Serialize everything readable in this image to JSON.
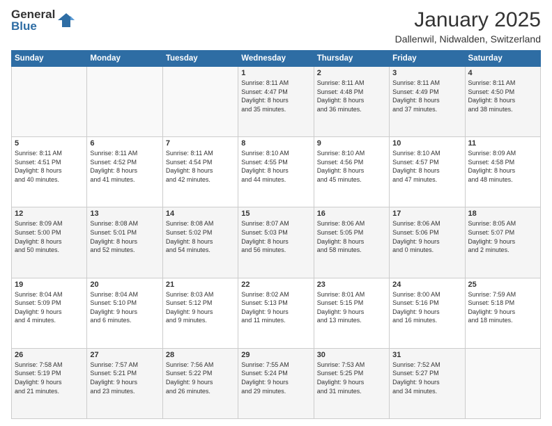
{
  "logo": {
    "general": "General",
    "blue": "Blue"
  },
  "title": "January 2025",
  "location": "Dallenwil, Nidwalden, Switzerland",
  "days_header": [
    "Sunday",
    "Monday",
    "Tuesday",
    "Wednesday",
    "Thursday",
    "Friday",
    "Saturday"
  ],
  "weeks": [
    [
      {
        "day": "",
        "info": ""
      },
      {
        "day": "",
        "info": ""
      },
      {
        "day": "",
        "info": ""
      },
      {
        "day": "1",
        "info": "Sunrise: 8:11 AM\nSunset: 4:47 PM\nDaylight: 8 hours\nand 35 minutes."
      },
      {
        "day": "2",
        "info": "Sunrise: 8:11 AM\nSunset: 4:48 PM\nDaylight: 8 hours\nand 36 minutes."
      },
      {
        "day": "3",
        "info": "Sunrise: 8:11 AM\nSunset: 4:49 PM\nDaylight: 8 hours\nand 37 minutes."
      },
      {
        "day": "4",
        "info": "Sunrise: 8:11 AM\nSunset: 4:50 PM\nDaylight: 8 hours\nand 38 minutes."
      }
    ],
    [
      {
        "day": "5",
        "info": "Sunrise: 8:11 AM\nSunset: 4:51 PM\nDaylight: 8 hours\nand 40 minutes."
      },
      {
        "day": "6",
        "info": "Sunrise: 8:11 AM\nSunset: 4:52 PM\nDaylight: 8 hours\nand 41 minutes."
      },
      {
        "day": "7",
        "info": "Sunrise: 8:11 AM\nSunset: 4:54 PM\nDaylight: 8 hours\nand 42 minutes."
      },
      {
        "day": "8",
        "info": "Sunrise: 8:10 AM\nSunset: 4:55 PM\nDaylight: 8 hours\nand 44 minutes."
      },
      {
        "day": "9",
        "info": "Sunrise: 8:10 AM\nSunset: 4:56 PM\nDaylight: 8 hours\nand 45 minutes."
      },
      {
        "day": "10",
        "info": "Sunrise: 8:10 AM\nSunset: 4:57 PM\nDaylight: 8 hours\nand 47 minutes."
      },
      {
        "day": "11",
        "info": "Sunrise: 8:09 AM\nSunset: 4:58 PM\nDaylight: 8 hours\nand 48 minutes."
      }
    ],
    [
      {
        "day": "12",
        "info": "Sunrise: 8:09 AM\nSunset: 5:00 PM\nDaylight: 8 hours\nand 50 minutes."
      },
      {
        "day": "13",
        "info": "Sunrise: 8:08 AM\nSunset: 5:01 PM\nDaylight: 8 hours\nand 52 minutes."
      },
      {
        "day": "14",
        "info": "Sunrise: 8:08 AM\nSunset: 5:02 PM\nDaylight: 8 hours\nand 54 minutes."
      },
      {
        "day": "15",
        "info": "Sunrise: 8:07 AM\nSunset: 5:03 PM\nDaylight: 8 hours\nand 56 minutes."
      },
      {
        "day": "16",
        "info": "Sunrise: 8:06 AM\nSunset: 5:05 PM\nDaylight: 8 hours\nand 58 minutes."
      },
      {
        "day": "17",
        "info": "Sunrise: 8:06 AM\nSunset: 5:06 PM\nDaylight: 9 hours\nand 0 minutes."
      },
      {
        "day": "18",
        "info": "Sunrise: 8:05 AM\nSunset: 5:07 PM\nDaylight: 9 hours\nand 2 minutes."
      }
    ],
    [
      {
        "day": "19",
        "info": "Sunrise: 8:04 AM\nSunset: 5:09 PM\nDaylight: 9 hours\nand 4 minutes."
      },
      {
        "day": "20",
        "info": "Sunrise: 8:04 AM\nSunset: 5:10 PM\nDaylight: 9 hours\nand 6 minutes."
      },
      {
        "day": "21",
        "info": "Sunrise: 8:03 AM\nSunset: 5:12 PM\nDaylight: 9 hours\nand 9 minutes."
      },
      {
        "day": "22",
        "info": "Sunrise: 8:02 AM\nSunset: 5:13 PM\nDaylight: 9 hours\nand 11 minutes."
      },
      {
        "day": "23",
        "info": "Sunrise: 8:01 AM\nSunset: 5:15 PM\nDaylight: 9 hours\nand 13 minutes."
      },
      {
        "day": "24",
        "info": "Sunrise: 8:00 AM\nSunset: 5:16 PM\nDaylight: 9 hours\nand 16 minutes."
      },
      {
        "day": "25",
        "info": "Sunrise: 7:59 AM\nSunset: 5:18 PM\nDaylight: 9 hours\nand 18 minutes."
      }
    ],
    [
      {
        "day": "26",
        "info": "Sunrise: 7:58 AM\nSunset: 5:19 PM\nDaylight: 9 hours\nand 21 minutes."
      },
      {
        "day": "27",
        "info": "Sunrise: 7:57 AM\nSunset: 5:21 PM\nDaylight: 9 hours\nand 23 minutes."
      },
      {
        "day": "28",
        "info": "Sunrise: 7:56 AM\nSunset: 5:22 PM\nDaylight: 9 hours\nand 26 minutes."
      },
      {
        "day": "29",
        "info": "Sunrise: 7:55 AM\nSunset: 5:24 PM\nDaylight: 9 hours\nand 29 minutes."
      },
      {
        "day": "30",
        "info": "Sunrise: 7:53 AM\nSunset: 5:25 PM\nDaylight: 9 hours\nand 31 minutes."
      },
      {
        "day": "31",
        "info": "Sunrise: 7:52 AM\nSunset: 5:27 PM\nDaylight: 9 hours\nand 34 minutes."
      },
      {
        "day": "",
        "info": ""
      }
    ]
  ]
}
